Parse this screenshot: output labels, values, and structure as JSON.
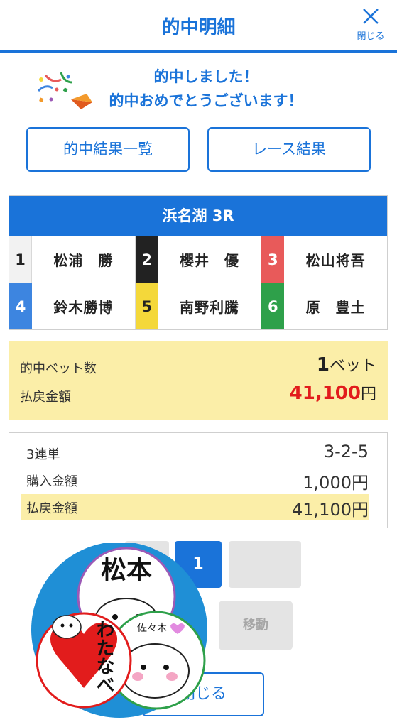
{
  "header": {
    "title": "的中明細",
    "close_label": "閉じる"
  },
  "congrats": {
    "line1": "的中しました！",
    "line2": "的中おめでとうございます！"
  },
  "buttons": {
    "hit_list": "的中結果一覧",
    "race_result": "レース結果"
  },
  "race": {
    "title": "浜名湖 3R",
    "racers": [
      {
        "boat": "1",
        "name": "松浦　勝"
      },
      {
        "boat": "2",
        "name": "櫻井　優"
      },
      {
        "boat": "3",
        "name": "松山将吾"
      },
      {
        "boat": "4",
        "name": "鈴木勝博"
      },
      {
        "boat": "5",
        "name": "南野利騰"
      },
      {
        "boat": "6",
        "name": "原　豊土"
      }
    ]
  },
  "summary": {
    "bets_label": "的中ベット数",
    "bets_value": "1",
    "bets_unit": "ベット",
    "payout_label": "払戻金額",
    "payout_value": "41,100",
    "payout_unit": "円"
  },
  "detail": {
    "bet_type": "3連単",
    "combination": "3-2-5",
    "purchase_label": "購入金額",
    "purchase_value": "1,000円",
    "payout_label": "払戻金額",
    "payout_value": "41,100円"
  },
  "pagination": {
    "current_page": "1",
    "move_label": "移動"
  },
  "footer": {
    "close_label": "閉じる"
  },
  "stickers": {
    "top_name": "松本",
    "right_name": "佐々木",
    "left_name": "わたなべ"
  },
  "colors": {
    "accent": "#1a73d9",
    "highlight": "#fbeea8",
    "payout": "#e21c1c"
  }
}
